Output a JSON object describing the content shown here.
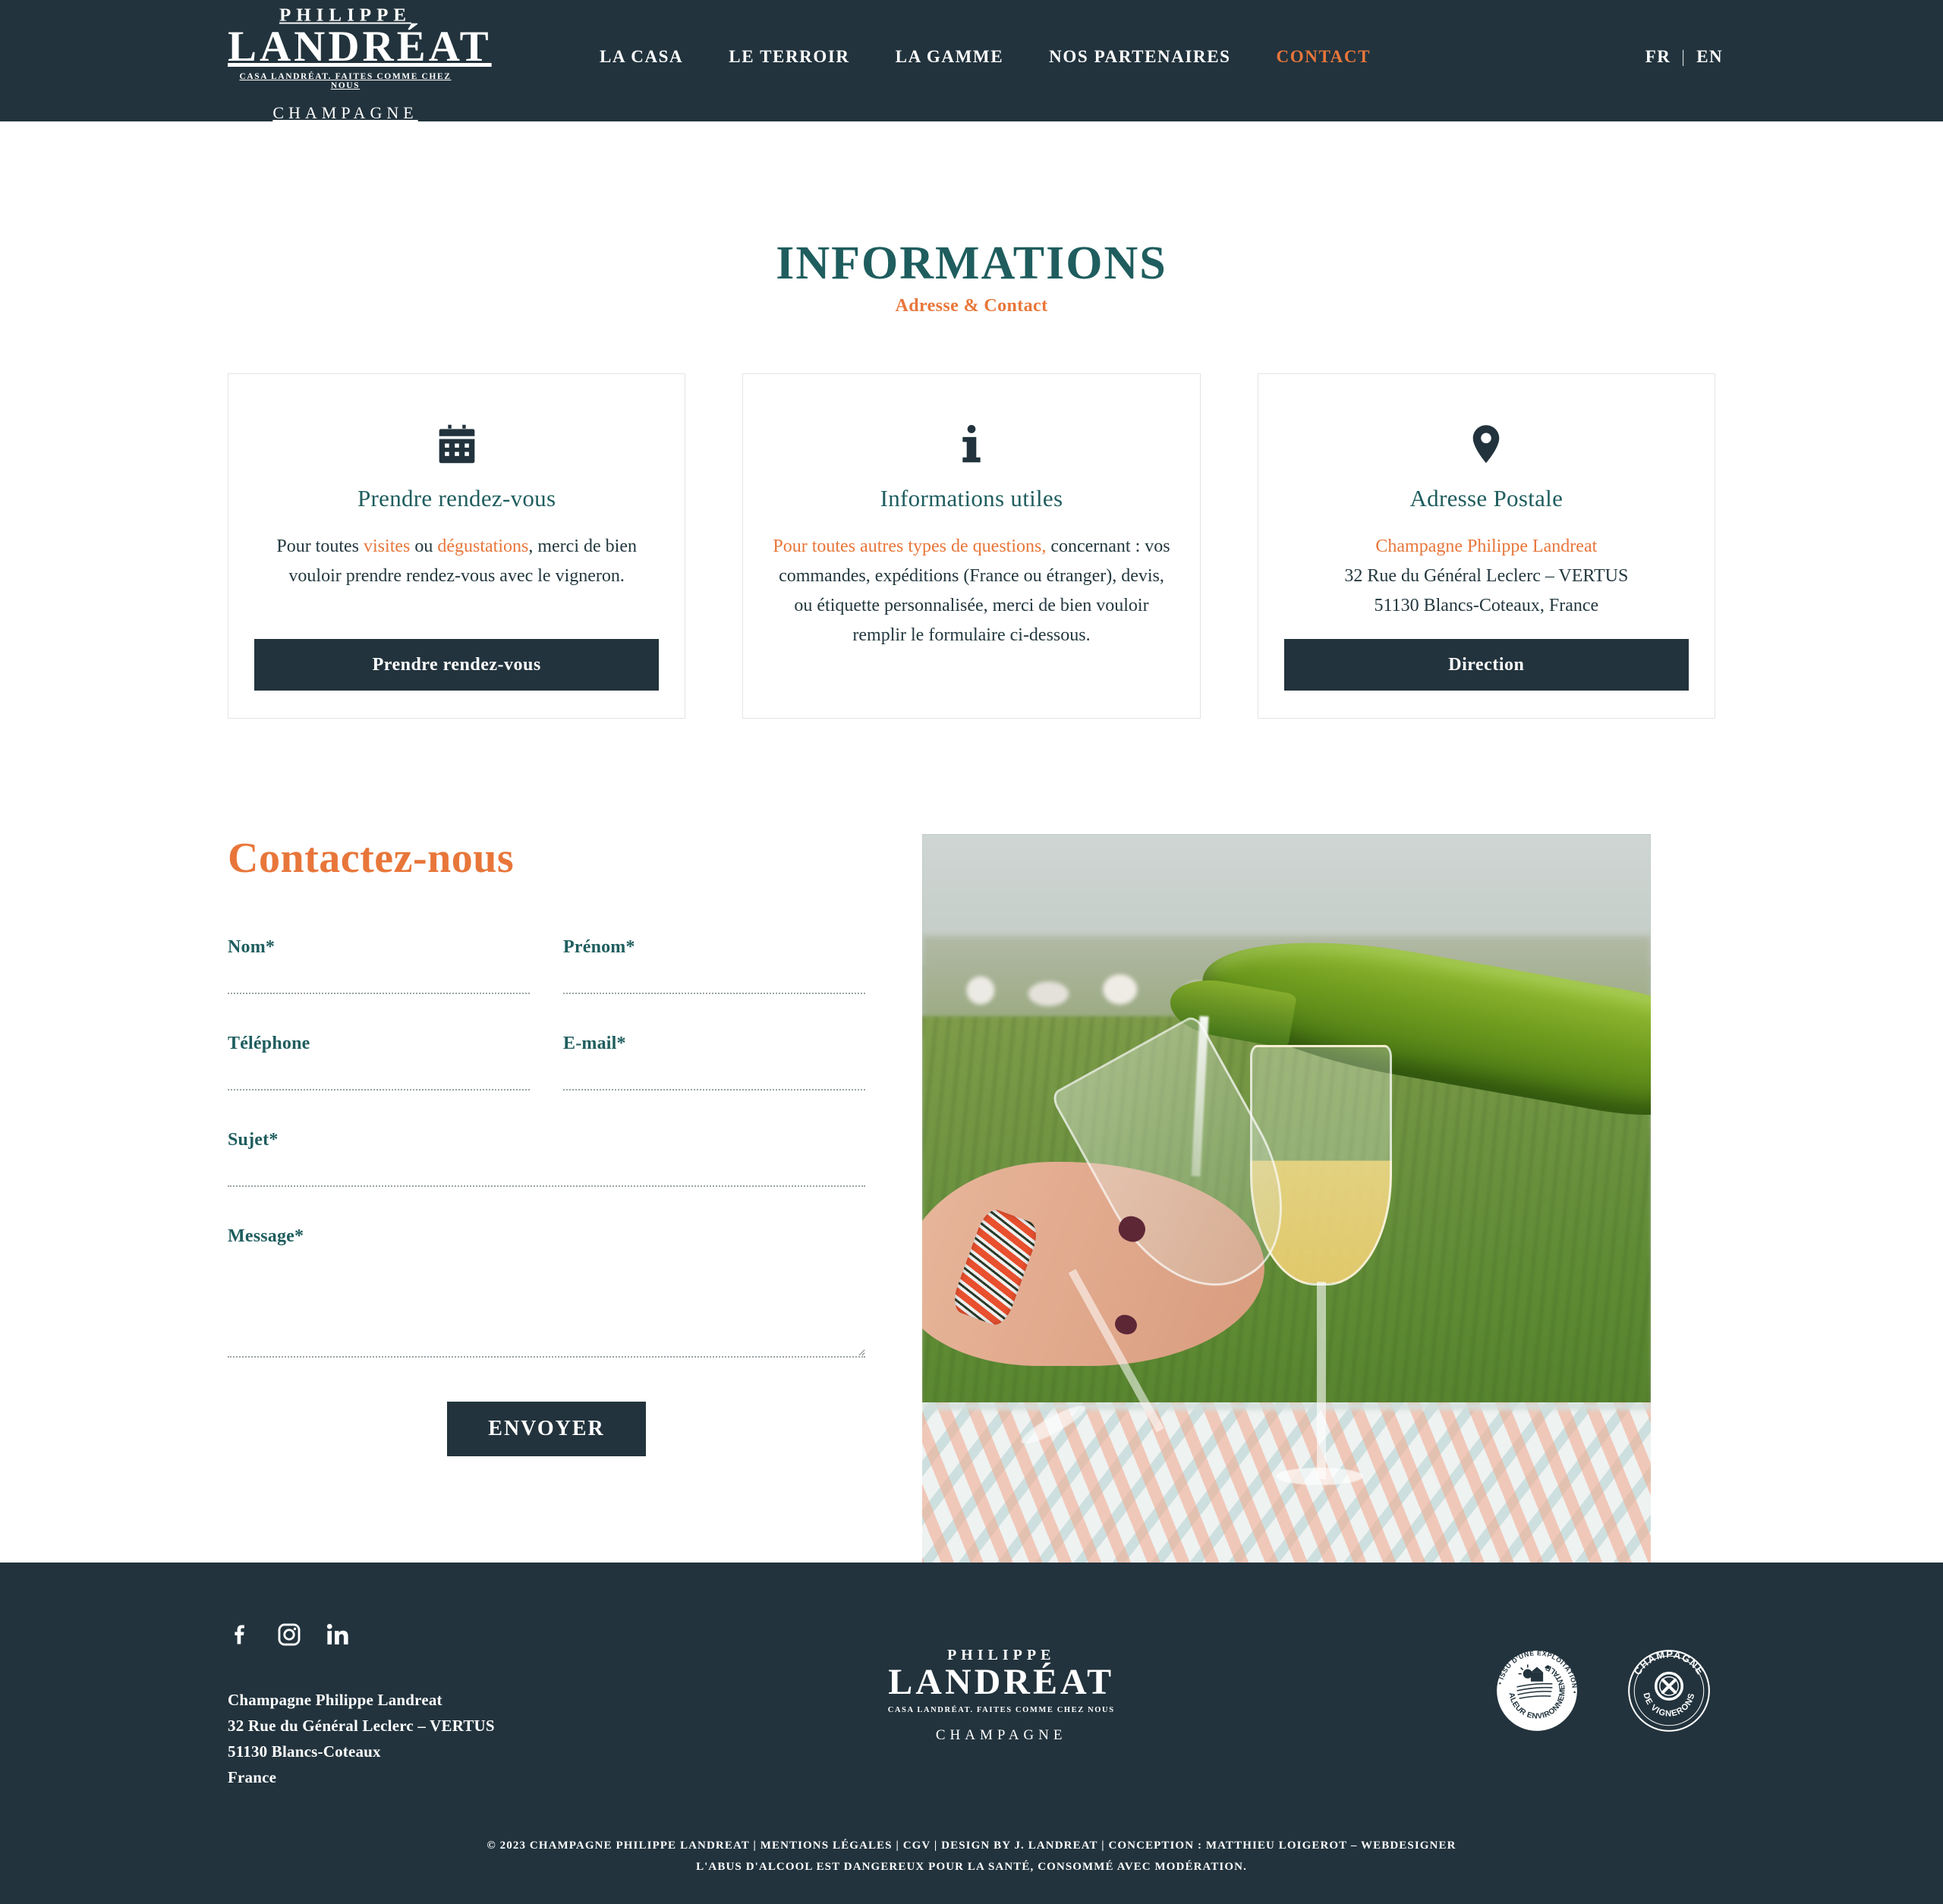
{
  "header": {
    "brand": {
      "line1": "PHILIPPE",
      "line2": "LANDRÉAT",
      "tagline": "CASA LANDRÉAT. FAITES COMME CHEZ NOUS",
      "line3": "CHAMPAGNE"
    },
    "nav": [
      {
        "label": "LA CASA",
        "active": false
      },
      {
        "label": "LE TERROIR",
        "active": false
      },
      {
        "label": "LA GAMME",
        "active": false
      },
      {
        "label": "NOS PARTENAIRES",
        "active": false
      },
      {
        "label": "CONTACT",
        "active": true
      }
    ],
    "lang": {
      "fr": "FR",
      "separator": "|",
      "en": "EN"
    },
    "colors": {
      "background": "#22333d",
      "accent": "#e8763a"
    }
  },
  "page": {
    "title": "INFORMATIONS",
    "subtitle": "Adresse & Contact",
    "title_color": "#1f5d5e",
    "subtitle_color": "#e8763a"
  },
  "cards": [
    {
      "icon": "calendar-icon",
      "title": "Prendre rendez-vous",
      "text_lead": "Pour toutes ",
      "text_hl1": "visites",
      "text_mid": " ou ",
      "text_hl2": "dégustations",
      "text_tail": ", merci de bien vouloir prendre rendez-vous avec le vigneron.",
      "button": "Prendre rendez-vous"
    },
    {
      "icon": "info-icon",
      "title": "Informations utiles",
      "text_lead": "Pour toutes autres types de questions,",
      "text_tail": " concernant : vos commandes, expéditions (France ou étranger), devis, ou étiquette personnalisée, merci de bien vouloir remplir le formulaire ci-dessous.",
      "button": null
    },
    {
      "icon": "location-pin-icon",
      "title": "Adresse Postale",
      "address_name": "Champagne Philippe Landreat",
      "address_line1": "32 Rue du Général Leclerc – VERTUS",
      "address_line2": "51130 Blancs-Coteaux, France",
      "button": "Direction"
    }
  ],
  "contact_form": {
    "heading": "Contactez-nous",
    "fields": [
      {
        "label": "Nom*",
        "value": "",
        "placeholder": "",
        "type": "text",
        "name": "nom"
      },
      {
        "label": "Prénom*",
        "value": "",
        "placeholder": "",
        "type": "text",
        "name": "prenom"
      },
      {
        "label": "Téléphone",
        "value": "",
        "placeholder": "",
        "type": "tel",
        "name": "telephone"
      },
      {
        "label": "E-mail*",
        "value": "",
        "placeholder": "",
        "type": "email",
        "name": "email"
      },
      {
        "label": "Sujet*",
        "value": "",
        "placeholder": "",
        "type": "text",
        "name": "sujet"
      },
      {
        "label": "Message*",
        "value": "",
        "placeholder": "",
        "type": "textarea",
        "name": "message"
      }
    ],
    "submit_label": "ENVOYER"
  },
  "photo": {
    "alt": "Champagne étant versé dans un verre devant les vignes"
  },
  "footer": {
    "social": [
      {
        "icon": "facebook-icon",
        "label": "Facebook"
      },
      {
        "icon": "instagram-icon",
        "label": "Instagram"
      },
      {
        "icon": "linkedin-icon",
        "label": "LinkedIn"
      }
    ],
    "address": [
      "Champagne Philippe Landreat",
      "32 Rue du Général Leclerc – VERTUS",
      "51130 Blancs-Coteaux",
      "France"
    ],
    "brand": {
      "line1": "PHILIPPE",
      "line2": "LANDRÉAT",
      "tagline": "CASA LANDRÉAT. FAITES COMME CHEZ NOUS",
      "line3": "CHAMPAGNE"
    },
    "badges": [
      {
        "icon": "hve-badge-icon",
        "text_outer": "ISSU D'UNE EXPLOITATION",
        "text_inner": "HAUTE VALEUR ENVIRONNEMENTALE"
      },
      {
        "icon": "champagne-de-vignerons-badge-icon",
        "text_outer": "CHAMPAGNE",
        "text_inner": "DE VIGNERONS"
      }
    ],
    "copyright_line1": "© 2023  CHAMPAGNE PHILIPPE LANDREAT | MENTIONS LÉGALES | CGV | DESIGN BY J. LANDREAT | CONCEPTION : MATTHIEU LOIGEROT – WEBDESIGNER",
    "copyright_line2": "L'ABUS D'ALCOOL EST DANGEREUX POUR LA SANTÉ, CONSOMMÉ AVEC MODÉRATION."
  }
}
